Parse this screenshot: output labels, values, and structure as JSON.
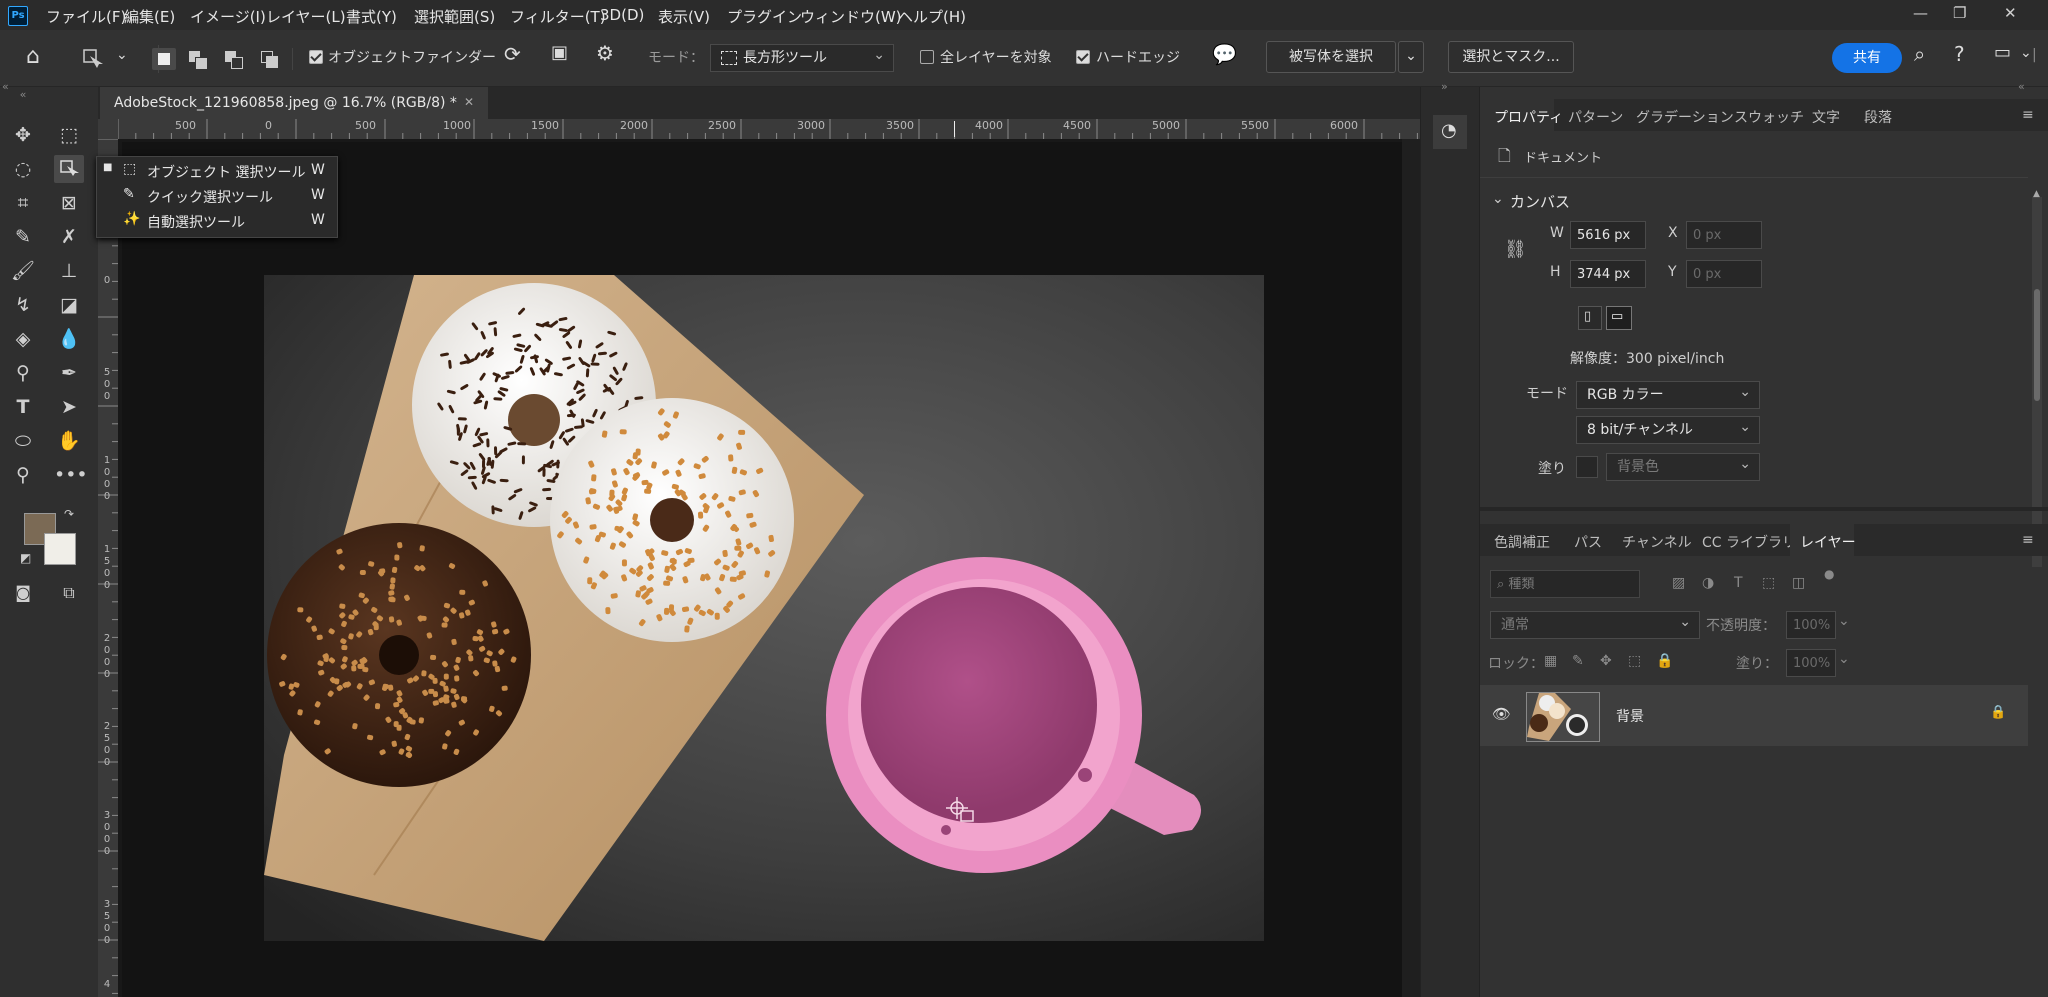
{
  "app": {
    "logo": "Ps"
  },
  "menu": [
    "ファイル(F)",
    "編集(E)",
    "イメージ(I)",
    "レイヤー(L)",
    "書式(Y)",
    "選択範囲(S)",
    "フィルター(T)",
    "3D(D)",
    "表示(V)",
    "プラグイン",
    "ウィンドウ(W)",
    "ヘルプ(H)"
  ],
  "options": {
    "object_finder": "オブジェクトファインダー",
    "mode_label": "モード：",
    "mode_value": "長方形ツール",
    "all_layers": "全レイヤーを対象",
    "hard_edge": "ハードエッジ",
    "select_subject": "被写体を選択",
    "select_mask": "選択とマスク...",
    "share": "共有"
  },
  "document": {
    "tab_title": "AdobeStock_121960858.jpeg @ 16.7% (RGB/8) *",
    "ruler_ticks": [
      "500",
      "0",
      "500",
      "1000",
      "1500",
      "2000",
      "2500",
      "3000",
      "3500",
      "4000",
      "4500",
      "5000",
      "5500",
      "6000"
    ],
    "vruler": [
      "0",
      "5\n0\n0",
      "1\n0\n0\n0",
      "1\n5\n0\n0",
      "2\n0\n0\n0",
      "2\n5\n0\n0",
      "3\n0\n0\n0",
      "3\n5\n0\n0",
      "4"
    ]
  },
  "flyout": {
    "items": [
      {
        "label": "オブジェクト 選択ツール",
        "key": "W"
      },
      {
        "label": "クイック選択ツール",
        "key": "W"
      },
      {
        "label": "自動選択ツール",
        "key": "W"
      }
    ]
  },
  "properties": {
    "tabs": [
      "プロパティ",
      "パターン",
      "グラデーション",
      "スウォッチ",
      "文字",
      "段落"
    ],
    "doc_label": "ドキュメント",
    "canvas_header": "カンバス",
    "w_label": "W",
    "w_value": "5616 px",
    "h_label": "H",
    "h_value": "3744 px",
    "x_label": "X",
    "x_value": "0 px",
    "y_label": "Y",
    "y_value": "0 px",
    "resolution": "解像度：300 pixel/inch",
    "mode_label": "モード",
    "mode_value": "RGB カラー",
    "bit_value": "8 bit/チャンネル",
    "fill_label": "塗り",
    "fill_value": "背景色"
  },
  "layers": {
    "tabs": [
      "色調補正",
      "パス",
      "チャンネル",
      "CC ライブラリ",
      "レイヤー"
    ],
    "search_placeholder": "種類",
    "blend_mode": "通常",
    "opacity_label": "不透明度：",
    "opacity_value": "100%",
    "lock_label": "ロック：",
    "fill_label": "塗り：",
    "fill_value": "100%",
    "layer_name": "背景"
  },
  "colors": {
    "foreground": "#7b6a55",
    "background": "#f0eee8",
    "share_blue": "#1473e6",
    "cup_pink": "#ea8ec1",
    "cup_fill": "#a84a7e"
  }
}
